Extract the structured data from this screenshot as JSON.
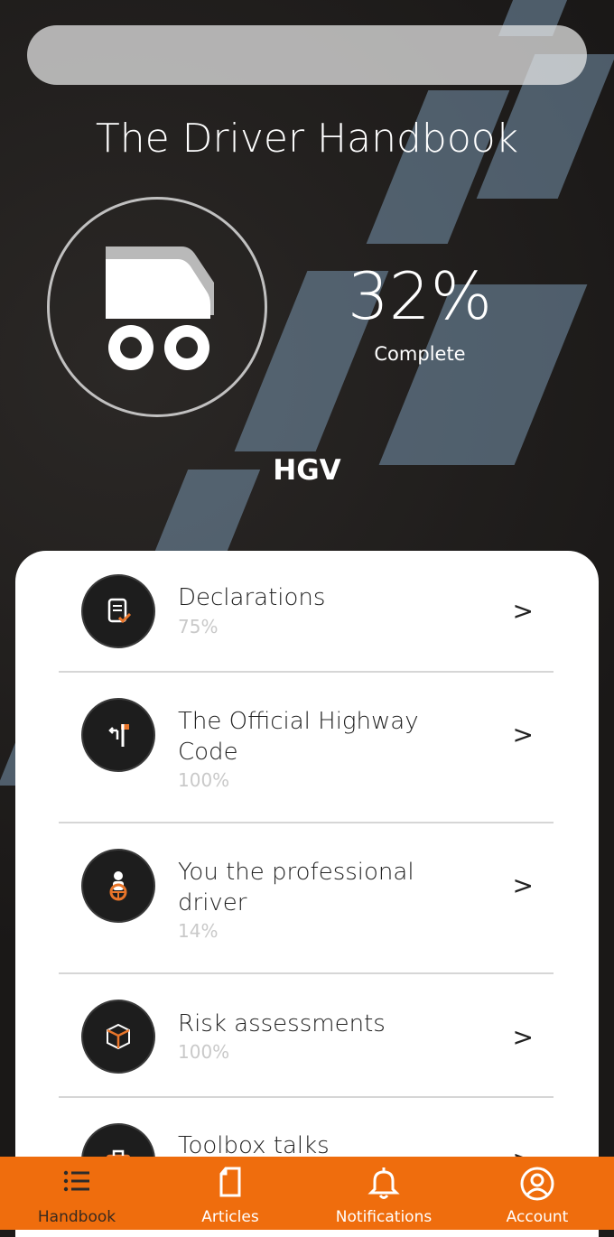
{
  "header": {
    "title": "The Driver Handbook",
    "search_value": ""
  },
  "progress": {
    "value": "32%",
    "label": "Complete",
    "fraction": 0.32,
    "vehicle_icon": "truck-icon",
    "vehicle": "HGV"
  },
  "sections": [
    {
      "title": "Declarations",
      "percent": "75%",
      "icon": "document-check-icon",
      "chevron": ">"
    },
    {
      "title": "The Official Highway Code",
      "percent": "100%",
      "icon": "road-sign-icon",
      "chevron": ">"
    },
    {
      "title": "You the professional driver",
      "percent": "14%",
      "icon": "driver-steering-icon",
      "chevron": ">"
    },
    {
      "title": "Risk assessments",
      "percent": "100%",
      "icon": "cube-icon",
      "chevron": ">"
    },
    {
      "title": "Toolbox talks",
      "percent": "",
      "icon": "toolbox-icon",
      "chevron": ">"
    }
  ],
  "tabs": [
    {
      "label": "Handbook",
      "icon": "list-icon",
      "active": true
    },
    {
      "label": "Articles",
      "icon": "document-icon",
      "active": false
    },
    {
      "label": "Notifications",
      "icon": "bell-icon",
      "active": false
    },
    {
      "label": "Account",
      "icon": "user-circle-icon",
      "active": false
    }
  ],
  "colors": {
    "accent": "#ef6d0d",
    "icon_accent": "#e8752a",
    "background_dark": "#1b1918"
  }
}
